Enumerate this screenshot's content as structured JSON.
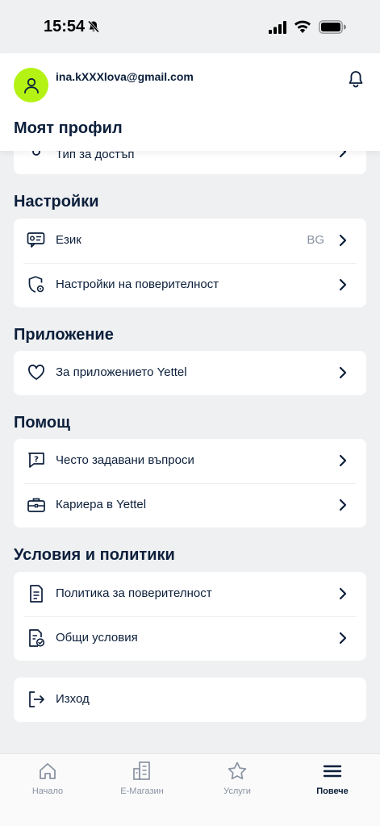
{
  "status_bar": {
    "time": "15:54"
  },
  "header": {
    "email": "ina.kXXXlova@gmail.com",
    "title": "Моят профил"
  },
  "cut_row": {
    "label": "Тип за достъп"
  },
  "sections": {
    "settings": {
      "title": "Настройки",
      "language_label": "Език",
      "language_value": "BG",
      "privacy_settings_label": "Настройки на поверителност"
    },
    "app": {
      "title": "Приложение",
      "about_label": "За приложението Yettel"
    },
    "help": {
      "title": "Помощ",
      "faq_label": "Често задавани въпроси",
      "career_label": "Кариера в Yettel"
    },
    "policies": {
      "title": "Условия и политики",
      "privacy_policy_label": "Политика за поверителност",
      "terms_label": "Общи условия"
    },
    "logout": {
      "label": "Изход"
    }
  },
  "bottom_nav": {
    "home": "Начало",
    "shop": "Е-Магазин",
    "services": "Услуги",
    "more": "Повече"
  },
  "colors": {
    "accent_green": "#b4f214",
    "text_dark": "#0c1f3b",
    "text_muted": "#8a93a3",
    "background": "#eff0f2"
  }
}
